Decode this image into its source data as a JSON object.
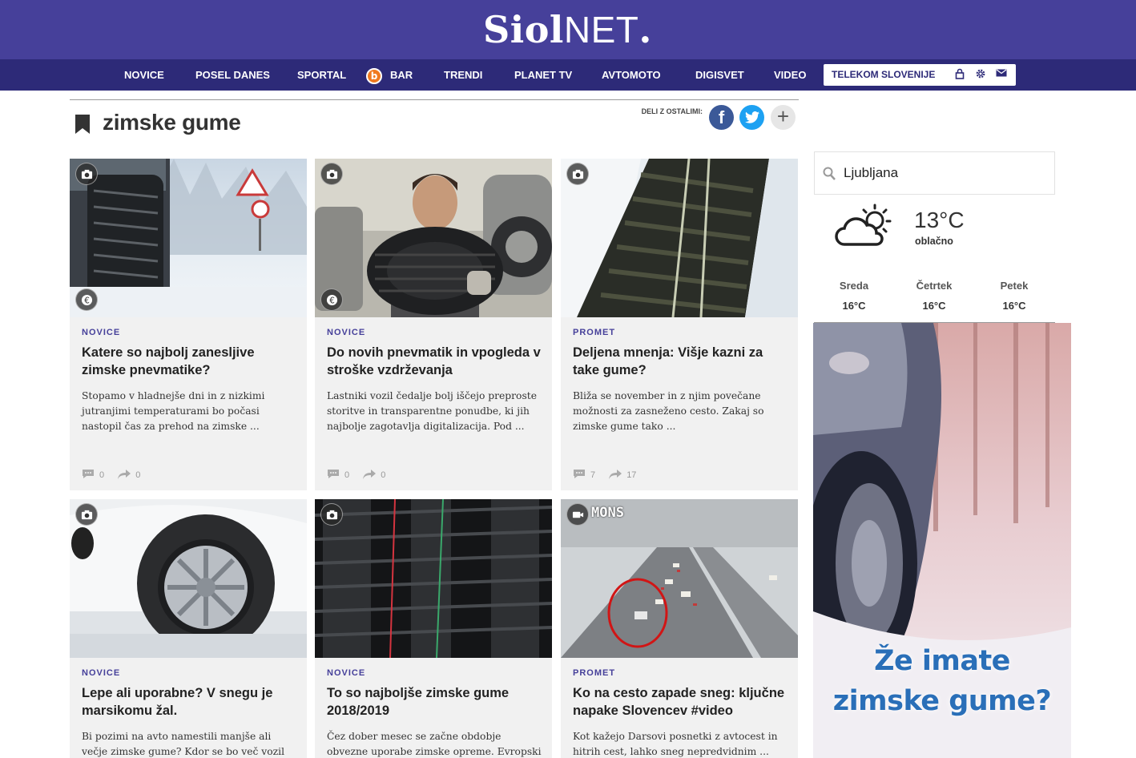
{
  "brand": {
    "name_bold": "Siol",
    "name_thin": "NET",
    "dot": "."
  },
  "nav": [
    {
      "label": "NOVICE"
    },
    {
      "label": "POSEL DANES"
    },
    {
      "label": "SPORTAL"
    },
    {
      "label": "BAR",
      "badge": "b"
    },
    {
      "label": "TRENDI"
    },
    {
      "label": "PLANET TV"
    },
    {
      "label": "AVTOMOTO"
    },
    {
      "label": "DIGISVET"
    },
    {
      "label": "VIDEO"
    }
  ],
  "telekom": {
    "label": "TELEKOM SLOVENIJE",
    "icons": [
      "lock-icon",
      "gear-icon",
      "mail-icon"
    ]
  },
  "page": {
    "title": "zimske gume",
    "share_label": "DELI Z OSTALIMI:"
  },
  "share": [
    {
      "name": "facebook",
      "glyph": "f",
      "color": "#3b5998"
    },
    {
      "name": "twitter",
      "color": "#1da1f2"
    },
    {
      "name": "more",
      "glyph": "+",
      "color": "#e6e6e6"
    }
  ],
  "articles": [
    {
      "category": "NOVICE",
      "headline": "Katere so najbolj zanesljive zimske pnevmatike?",
      "excerpt": "Stopamo v hladnejše dni in z nizkimi jutranjimi temperaturami bo počasi nastopil čas za prehod na zimske ...",
      "comments": "0",
      "shares": "0",
      "media": "photo",
      "sponsored": true
    },
    {
      "category": "NOVICE",
      "headline": "Do novih pnevmatik in vpogleda v stroške vzdrževanja",
      "excerpt": "Lastniki vozil čedalje bolj iščejo preproste storitve in transparentne ponudbe, ki jih najbolje zagotavlja digitalizacija. Pod ...",
      "comments": "0",
      "shares": "0",
      "media": "photo",
      "sponsored": true
    },
    {
      "category": "PROMET",
      "headline": "Deljena mnenja: Višje kazni za take gume?",
      "excerpt": "Bliža se november in z njim povečane možnosti za zasneženo cesto. Zakaj so zimske gume tako ...",
      "comments": "7",
      "shares": "17",
      "media": "photo",
      "sponsored": false
    },
    {
      "category": "NOVICE",
      "headline": "Lepe ali uporabne? V snegu je marsikomu žal.",
      "excerpt": "Bi pozimi na avto namestili manjše ali večje zimske gume? Kdor se bo več vozil po ...",
      "media": "photo",
      "sponsored": false
    },
    {
      "category": "NOVICE",
      "headline": "To so najboljše zimske gume 2018/2019",
      "excerpt": "Čez dober mesec se začne obdobje obvezne uporabe zimske opreme. Evropski ...",
      "media": "photo",
      "sponsored": false
    },
    {
      "category": "PROMET",
      "headline": "Ko na cesto zapade sneg: ključne napake Slovencev #video",
      "excerpt": "Kot kažejo Darsovi posnetki z avtocest in hitrih cest, lahko sneg nepredvidnim ...",
      "media": "video",
      "overlay": "MONS",
      "sponsored": false
    }
  ],
  "weather": {
    "search_value": "Ljubljana",
    "now": {
      "temp": "13°C",
      "condition": "oblačno",
      "icon": "partly-cloudy-icon"
    },
    "forecast": [
      {
        "day": "Sreda",
        "temp": "16°C"
      },
      {
        "day": "Četrtek",
        "temp": "16°C"
      },
      {
        "day": "Petek",
        "temp": "16°C"
      }
    ]
  },
  "ad": {
    "line1": "Že imate",
    "line2": "zimske gume?"
  },
  "colors": {
    "brand": "#46409a",
    "nav": "#2d2a78",
    "category": "#46409a",
    "card_bg": "#f1f1f1",
    "ad_text": "#2a6fb8"
  }
}
